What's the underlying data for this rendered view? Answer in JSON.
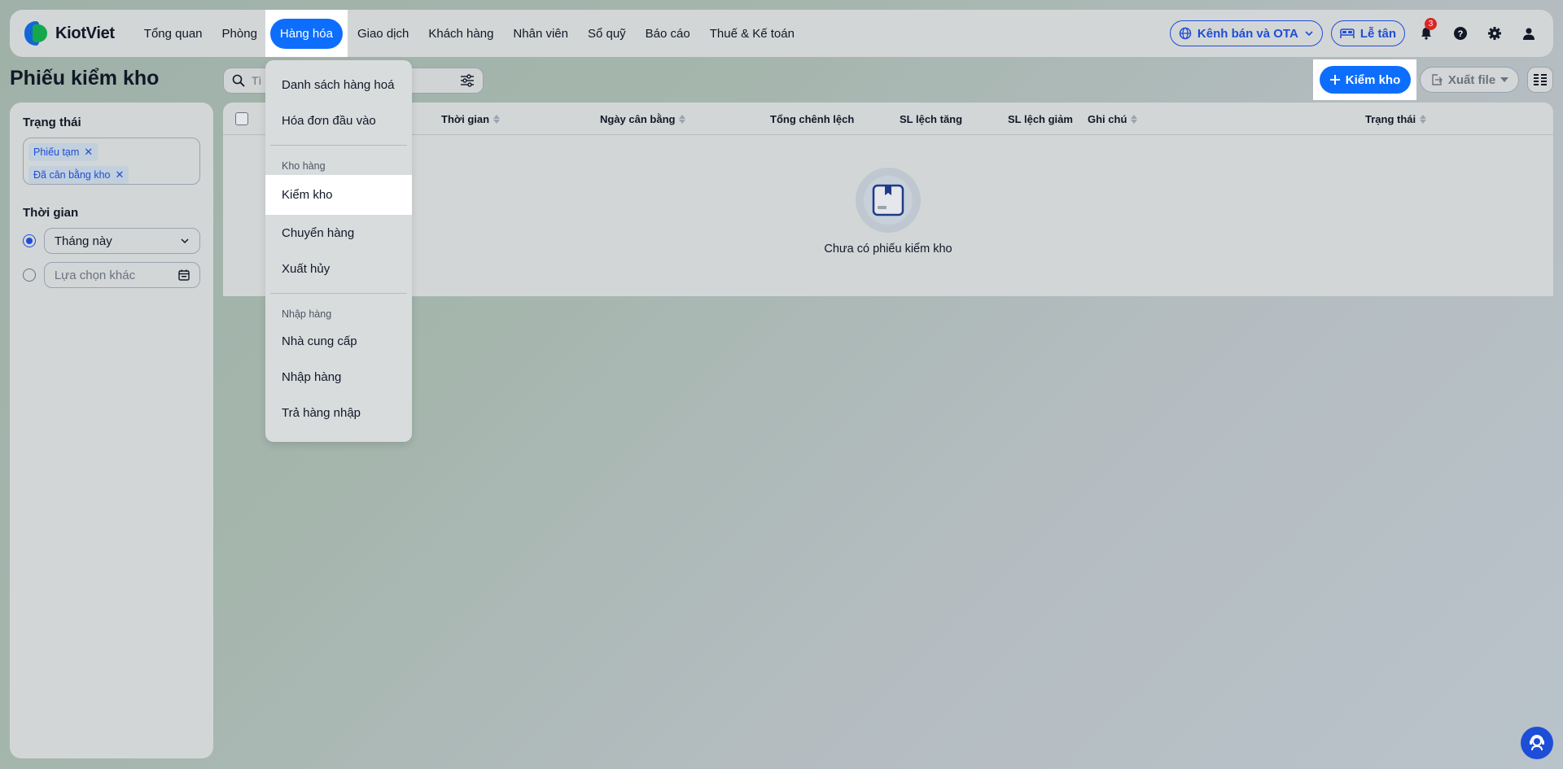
{
  "app": {
    "brand": "KiotViet",
    "brand_colors": {
      "blue": "#1466d8",
      "green": "#15a84a",
      "accent": "#0d6efd"
    }
  },
  "nav": {
    "items": [
      "Tổng quan",
      "Phòng",
      "Hàng hóa",
      "Giao dịch",
      "Khách hàng",
      "Nhân viên",
      "Sổ quỹ",
      "Báo cáo",
      "Thuế & Kế toán"
    ],
    "active": "Hàng hóa"
  },
  "top_right": {
    "channels_label": "Kênh bán và OTA",
    "reception_label": "Lễ tân",
    "notification_count": "3",
    "icons": [
      "bell-icon",
      "help-icon",
      "gear-icon",
      "user-icon"
    ]
  },
  "page": {
    "title": "Phiếu kiểm kho"
  },
  "search": {
    "placeholder": "Tì"
  },
  "actions": {
    "add_label": "Kiểm kho",
    "export_label": "Xuất file"
  },
  "sidebar": {
    "status_label": "Trạng thái",
    "status_tags": [
      "Phiếu tạm",
      "Đã cân bằng kho"
    ],
    "time_label": "Thời gian",
    "time_option_selected": "Tháng này",
    "time_option_other": "Lựa chọn khác"
  },
  "table": {
    "columns": [
      "Thời gian",
      "Ngày cân bằng",
      "Tổng chênh lệch",
      "SL lệch tăng",
      "SL lệch giảm",
      "Ghi chú",
      "Trạng thái"
    ],
    "empty_text": "Chưa có phiếu kiểm kho"
  },
  "dropdown": {
    "items_top": [
      "Danh sách hàng hoá",
      "Hóa đơn đầu vào"
    ],
    "group1": "Kho hàng",
    "group1_items": [
      "Kiểm kho",
      "Chuyển hàng",
      "Xuất hủy"
    ],
    "group2": "Nhập hàng",
    "group2_items": [
      "Nhà cung cấp",
      "Nhập hàng",
      "Trả hàng nhập"
    ],
    "active_item": "Kiểm kho"
  }
}
